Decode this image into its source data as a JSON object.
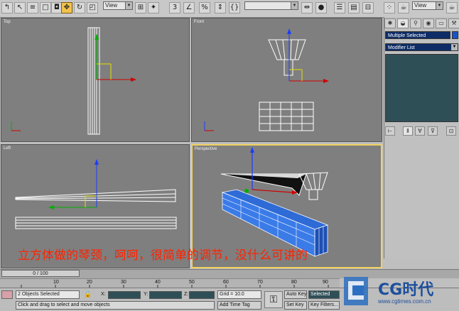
{
  "toolbar": {
    "view_dropdown_1": "View",
    "view_dropdown_2": "View",
    "selection_set": "",
    "snap_value": "3"
  },
  "viewports": {
    "top": "Top",
    "front": "Front",
    "left": "Left",
    "perspective": "Perspective"
  },
  "command_panel": {
    "object_name": "Multiple Selected",
    "modifier_list": "Modifier List",
    "color": "#1a52c8"
  },
  "caption": "立方体做的琴颈，呵呵，很简单的调节，没什么可讲的",
  "timeline": {
    "slider_label": "0 / 100",
    "ticks": [
      "10",
      "20",
      "30",
      "40",
      "50",
      "60",
      "70",
      "80",
      "90"
    ]
  },
  "status": {
    "selection": "2 Objects Selected",
    "prompt": "Click and drag to select and move objects",
    "x_label": "X:",
    "y_label": "Y:",
    "z_label": "Z:",
    "grid": "Grid = 10.0",
    "add_time_tag": "Add Time Tag",
    "auto_key": "Auto Key",
    "selected": "Selected",
    "set_key": "Set Key",
    "key_filters": "Key Filters..."
  },
  "watermark": {
    "brand": "CG时代",
    "url": "www.cgtimes.com.cn"
  }
}
